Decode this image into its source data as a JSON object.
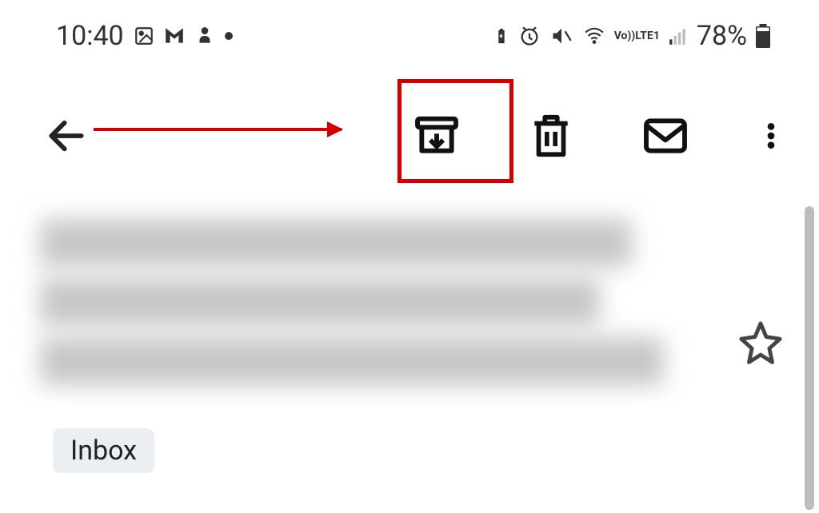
{
  "status": {
    "time": "10:40",
    "battery": "78%",
    "network_label": "LTE1",
    "vo_label": "Vo))"
  },
  "toolbar": {
    "back_name": "back",
    "archive_name": "archive",
    "delete_name": "delete",
    "mark_unread_name": "mark-unread",
    "more_name": "more"
  },
  "email": {
    "label_chip": "Inbox",
    "starred": false
  },
  "annotation": {
    "highlight_target": "archive-button"
  }
}
